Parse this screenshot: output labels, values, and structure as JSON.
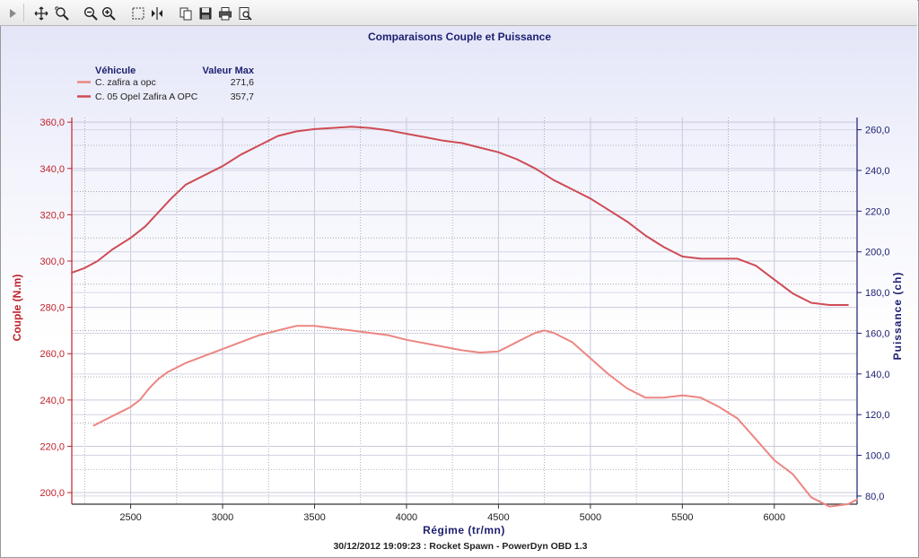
{
  "chart_data": {
    "type": "line",
    "title": "Comparaisons Couple et Puissance",
    "footer": "30/12/2012 19:09:23 : Rocket Spawn - PowerDyn OBD 1.3",
    "xlabel": "Régime (tr/mn)",
    "ylabel_left": "Couple (N.m)",
    "ylabel_right": "Puissance (ch)",
    "xlim": [
      2180,
      6450
    ],
    "ylim_left": [
      195,
      362
    ],
    "ylim_right": [
      76,
      266
    ],
    "x_ticks": [
      2500,
      3000,
      3500,
      4000,
      4500,
      5000,
      5500,
      6000
    ],
    "y_ticks_left": [
      "200,0",
      "220,0",
      "240,0",
      "260,0",
      "280,0",
      "300,0",
      "320,0",
      "340,0",
      "360,0"
    ],
    "y_ticks_right": [
      "80,0",
      "100,0",
      "120,0",
      "140,0",
      "160,0",
      "180,0",
      "200,0",
      "220,0",
      "240,0",
      "260,0"
    ],
    "legend": {
      "col_vehicle": "Véhicule",
      "col_max": "Valeur Max",
      "entries": [
        {
          "name": "C. zafira a opc",
          "max": "271,6",
          "color": "#ec8682"
        },
        {
          "name": "C. 05 Opel Zafira A OPC",
          "max": "357,7",
          "color": "#cf4b55"
        }
      ]
    },
    "grid": true,
    "series": [
      {
        "name": "C. 05 Opel Zafira A OPC",
        "color": "#cf4b55",
        "axis": "left",
        "x": [
          2180,
          2250,
          2320,
          2400,
          2500,
          2580,
          2650,
          2720,
          2800,
          2900,
          3000,
          3100,
          3200,
          3300,
          3400,
          3500,
          3600,
          3700,
          3800,
          3900,
          4000,
          4100,
          4200,
          4300,
          4400,
          4500,
          4600,
          4700,
          4800,
          4900,
          5000,
          5100,
          5200,
          5300,
          5400,
          5500,
          5600,
          5700,
          5800,
          5900,
          6000,
          6100,
          6200,
          6300,
          6400
        ],
        "y": [
          295,
          297,
          300,
          305,
          310,
          315,
          321,
          327,
          333,
          337,
          341,
          346,
          350,
          354,
          356,
          357,
          357.5,
          358,
          357.5,
          356.5,
          355,
          353.5,
          352,
          351,
          349,
          347,
          344,
          340,
          335,
          331,
          327,
          322,
          317,
          311,
          306,
          302,
          301,
          301,
          301,
          298,
          292,
          286,
          282,
          281,
          281
        ]
      },
      {
        "name": "C. zafira a opc",
        "color": "#ec8682",
        "axis": "left",
        "x": [
          2300,
          2350,
          2400,
          2450,
          2500,
          2550,
          2600,
          2650,
          2700,
          2800,
          2900,
          3000,
          3100,
          3200,
          3300,
          3400,
          3500,
          3600,
          3700,
          3800,
          3900,
          4000,
          4100,
          4200,
          4300,
          4400,
          4500,
          4600,
          4700,
          4750,
          4800,
          4900,
          5000,
          5100,
          5200,
          5300,
          5400,
          5500,
          5600,
          5700,
          5800,
          5900,
          6000,
          6100,
          6200,
          6300,
          6400,
          6450
        ],
        "y": [
          229,
          231,
          233,
          235,
          237,
          240,
          245,
          249,
          252,
          256,
          259,
          262,
          265,
          268,
          270,
          272,
          272,
          271,
          270,
          269,
          268,
          266,
          264.5,
          263,
          261.5,
          260.5,
          261,
          265,
          269,
          270,
          269,
          265,
          258,
          251,
          245,
          241,
          241,
          242,
          241,
          237,
          232,
          223,
          214,
          208,
          198,
          194,
          195,
          197
        ]
      }
    ]
  }
}
